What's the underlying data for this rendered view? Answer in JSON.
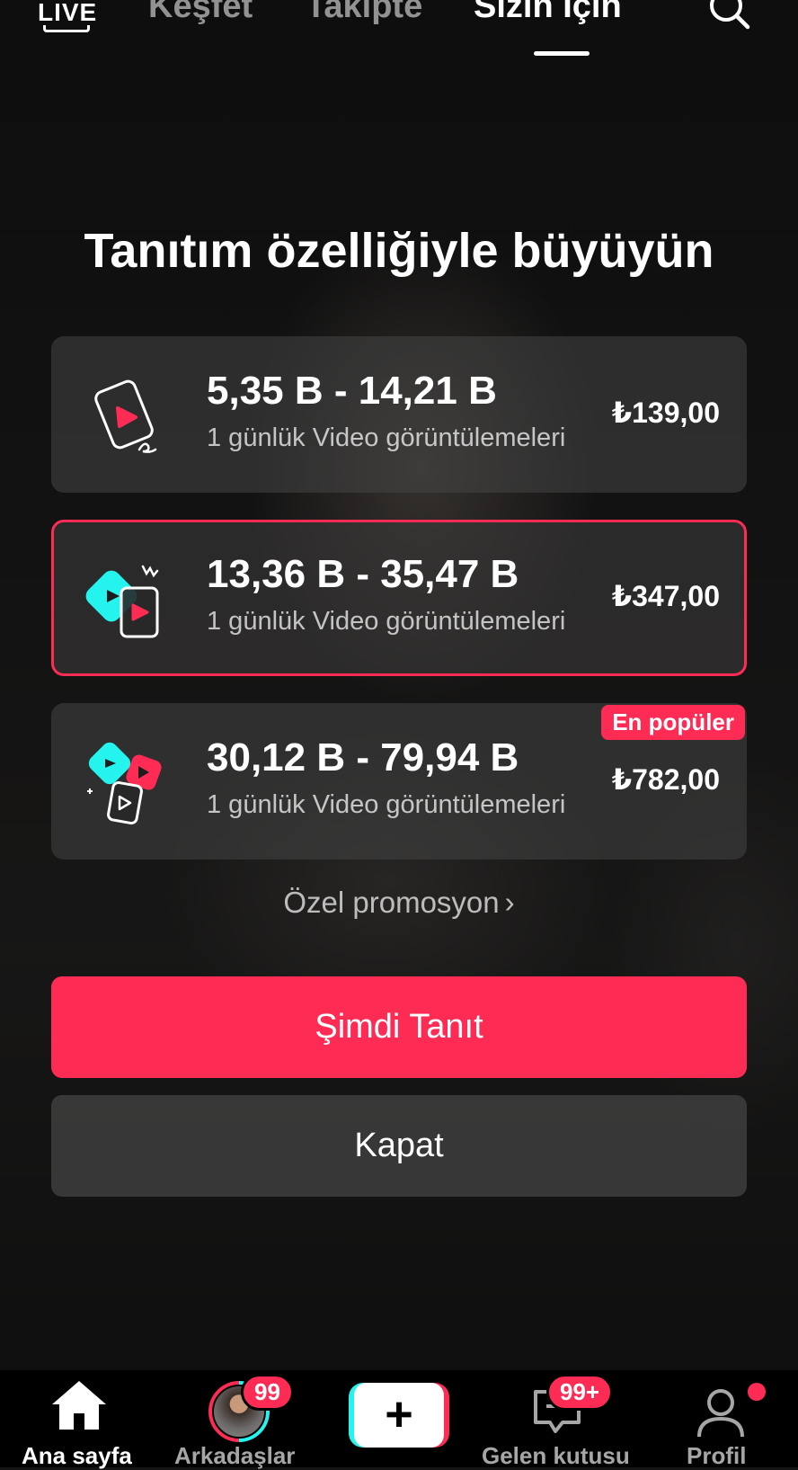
{
  "top_nav": {
    "live_label": "LIVE",
    "tabs": [
      {
        "label": "Keşfet",
        "active": false
      },
      {
        "label": "Takipte",
        "active": false
      },
      {
        "label": "Sizin İçin",
        "active": true
      }
    ],
    "search_icon": "search-icon"
  },
  "promo": {
    "heading": "Tanıtım özelliğiyle büyüyün",
    "options": [
      {
        "range": "5,35 B - 14,21 B",
        "subtitle": "1 günlük Video görüntülemeleri",
        "price": "₺139,00",
        "selected": false,
        "icon": "single-video-icon"
      },
      {
        "range": "13,36 B - 35,47 B",
        "subtitle": "1 günlük Video görüntülemeleri",
        "price": "₺347,00",
        "selected": true,
        "icon": "double-video-icon"
      },
      {
        "range": "30,12 B - 79,94 B",
        "subtitle": "1 günlük Video görüntülemeleri",
        "price": "₺782,00",
        "selected": false,
        "badge": "En popüler",
        "icon": "triple-video-icon"
      }
    ],
    "special_link": "Özel promosyon",
    "primary_button": "Şimdi Tanıt",
    "secondary_button": "Kapat"
  },
  "bottom_nav": {
    "home_label": "Ana sayfa",
    "friends_label": "Arkadaşlar",
    "friends_badge": "99",
    "create_symbol": "+",
    "inbox_label": "Gelen kutusu",
    "inbox_badge": "99+",
    "profile_label": "Profil"
  },
  "colors": {
    "accent": "#fe2c55",
    "cyan": "#25f4ee",
    "card_bg": "#464646"
  }
}
